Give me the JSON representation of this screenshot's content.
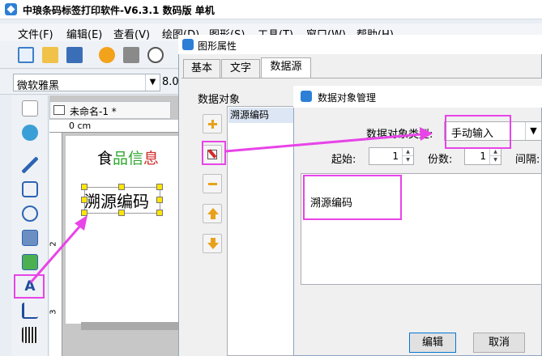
{
  "app": {
    "title": "中琅条码标签打印软件-V6.3.1 数码版 单机"
  },
  "menu": [
    "文件(F)",
    "编辑(E)",
    "查看(V)",
    "绘图(D)",
    "图形(S)",
    "工具(T)",
    "窗口(W)",
    "帮助(H)"
  ],
  "font": {
    "name": "微软雅黑",
    "size": "8.0"
  },
  "document": {
    "tab_title": "未命名-1 *",
    "ruler_unit": "0 cm",
    "ruler_num_2": "2",
    "ruler_num_3": "3"
  },
  "canvas": {
    "label_text": {
      "p1": "食",
      "p2": "品",
      "p3": "信",
      "p4": "息"
    },
    "selected_text": "溯源编码"
  },
  "dialog_props": {
    "title": "图形属性",
    "tabs": [
      "基本",
      "文字",
      "数据源"
    ],
    "group_label": "数据对象",
    "list_items": [
      "溯源编码"
    ]
  },
  "dialog_manage": {
    "title": "数据对象管理",
    "type_label": "数据对象类型:",
    "type_value": "手动输入",
    "start_label": "起始:",
    "start_value": "1",
    "copies_label": "份数:",
    "copies_value": "1",
    "interval_label": "间隔:",
    "content": "溯源编码",
    "edit_button": "编辑",
    "cancel_button": "取消"
  },
  "colors": {
    "highlight": "#e844e8",
    "accent": "#2d7fd6",
    "green": "#2fa82f",
    "red": "#d42a2a"
  }
}
